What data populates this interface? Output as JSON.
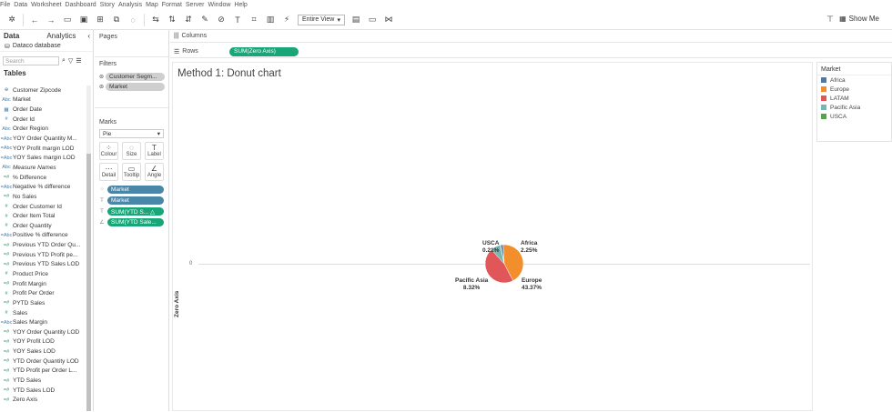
{
  "menubar": [
    "File",
    "Data",
    "Worksheet",
    "Dashboard",
    "Story",
    "Analysis",
    "Map",
    "Format",
    "Server",
    "Window",
    "Help"
  ],
  "toolbar": {
    "fit_select": "Entire View",
    "show_me": "Show Me"
  },
  "left_panel": {
    "tabs": {
      "data": "Data",
      "analytics": "Analytics"
    },
    "datasource": "Dataco database",
    "search_placeholder": "Search",
    "tables_heading": "Tables",
    "fields": [
      {
        "icon": "⊕",
        "label": "Customer Zipcode",
        "measure": false
      },
      {
        "icon": "Abc",
        "label": "Market",
        "measure": false
      },
      {
        "icon": "▦",
        "label": "Order Date",
        "measure": false
      },
      {
        "icon": "#",
        "label": "Order Id",
        "measure": false
      },
      {
        "icon": "Abc",
        "label": "Order Region",
        "measure": false
      },
      {
        "icon": "=Abc",
        "label": "YOY Order Quantity M...",
        "measure": false
      },
      {
        "icon": "=Abc",
        "label": "YOY Profit margin LOD",
        "measure": false
      },
      {
        "icon": "=Abc",
        "label": "YOY Sales margin LOD",
        "measure": false
      },
      {
        "icon": "Abc",
        "label": "Measure Names",
        "measure": false,
        "italic": true
      },
      {
        "icon": "=#",
        "label": "% Difference",
        "measure": true
      },
      {
        "icon": "=Abc",
        "label": "Negative % difference",
        "measure": false
      },
      {
        "icon": "=#",
        "label": "No Sales",
        "measure": true
      },
      {
        "icon": "#",
        "label": "Order Customer Id",
        "measure": true
      },
      {
        "icon": "#",
        "label": "Order Item Total",
        "measure": true
      },
      {
        "icon": "#",
        "label": "Order Quantity",
        "measure": true
      },
      {
        "icon": "=Abc",
        "label": "Positive % difference",
        "measure": false
      },
      {
        "icon": "=#",
        "label": "Previous YTD Order Qu...",
        "measure": true
      },
      {
        "icon": "=#",
        "label": "Previous YTD Profit pe...",
        "measure": true
      },
      {
        "icon": "=#",
        "label": "Previous YTD Sales LOD",
        "measure": true
      },
      {
        "icon": "#",
        "label": "Product Price",
        "measure": true
      },
      {
        "icon": "=#",
        "label": "Profit Margin",
        "measure": true
      },
      {
        "icon": "#",
        "label": "Profit Per Order",
        "measure": true
      },
      {
        "icon": "=#",
        "label": "PYTD Sales",
        "measure": true
      },
      {
        "icon": "#",
        "label": "Sales",
        "measure": true
      },
      {
        "icon": "=Abc",
        "label": "Sales Margin",
        "measure": false
      },
      {
        "icon": "=#",
        "label": "YOY Order Quantity LOD",
        "measure": true
      },
      {
        "icon": "=#",
        "label": "YOY Profit LOD",
        "measure": true
      },
      {
        "icon": "=#",
        "label": "YOY Sales LOD",
        "measure": true
      },
      {
        "icon": "=#",
        "label": "YTD Order Quantity LOD",
        "measure": true
      },
      {
        "icon": "=#",
        "label": "YTD Profit per Order L...",
        "measure": true
      },
      {
        "icon": "=#",
        "label": "YTD Sales",
        "measure": true
      },
      {
        "icon": "=#",
        "label": "YTD Sales LOD",
        "measure": true
      },
      {
        "icon": "=#",
        "label": "Zero Axis",
        "measure": true
      }
    ]
  },
  "cards": {
    "pages_title": "Pages",
    "filters_title": "Filters",
    "filters": [
      "Customer Segm...",
      "Market"
    ],
    "marks_title": "Marks",
    "mark_type": "Pie",
    "mark_buttons": [
      {
        "glyph": "⁘",
        "label": "Colour"
      },
      {
        "glyph": "◌",
        "label": "Size"
      },
      {
        "glyph": "T",
        "label": "Label"
      },
      {
        "glyph": "⋯",
        "label": "Detail"
      },
      {
        "glyph": "▭",
        "label": "Tooltip"
      },
      {
        "glyph": "∠",
        "label": "Angle"
      }
    ],
    "mark_pills": [
      {
        "icon": "⁘",
        "label": "Market",
        "kind": "blue"
      },
      {
        "icon": "T",
        "label": "Market",
        "kind": "blue"
      },
      {
        "icon": "T",
        "label": "SUM(YTD S... △",
        "kind": "green"
      },
      {
        "icon": "∠",
        "label": "SUM(YTD Sale...",
        "kind": "green"
      }
    ]
  },
  "shelves": {
    "columns_label": "Columns",
    "rows_label": "Rows",
    "rows_pill": "SUM(Zero Axis)"
  },
  "view": {
    "title": "Method 1: Donut chart",
    "axis_title": "Zero Axis",
    "axis_tick": "0"
  },
  "chart_data": {
    "type": "pie",
    "title": "Method 1: Donut chart",
    "slices": [
      {
        "name": "Africa",
        "value": 2.25,
        "label": "2.25%",
        "color": "#4e79a7"
      },
      {
        "name": "Europe",
        "value": 43.37,
        "label": "43.37%",
        "color": "#f28e2b"
      },
      {
        "name": "LATAM",
        "value": 45.85,
        "label": "",
        "color": "#e15759"
      },
      {
        "name": "Pacific Asia",
        "value": 8.32,
        "label": "8.32%",
        "color": "#76b7b2"
      },
      {
        "name": "USCA",
        "value": 0.21,
        "label": "0.21%",
        "color": "#59a14f"
      }
    ],
    "legend_position": "right"
  },
  "legend": {
    "title": "Market",
    "items": [
      {
        "label": "Africa",
        "color": "#4e79a7"
      },
      {
        "label": "Europe",
        "color": "#f28e2b"
      },
      {
        "label": "LATAM",
        "color": "#e15759"
      },
      {
        "label": "Pacific Asia",
        "color": "#76b7b2"
      },
      {
        "label": "USCA",
        "color": "#59a14f"
      }
    ]
  }
}
